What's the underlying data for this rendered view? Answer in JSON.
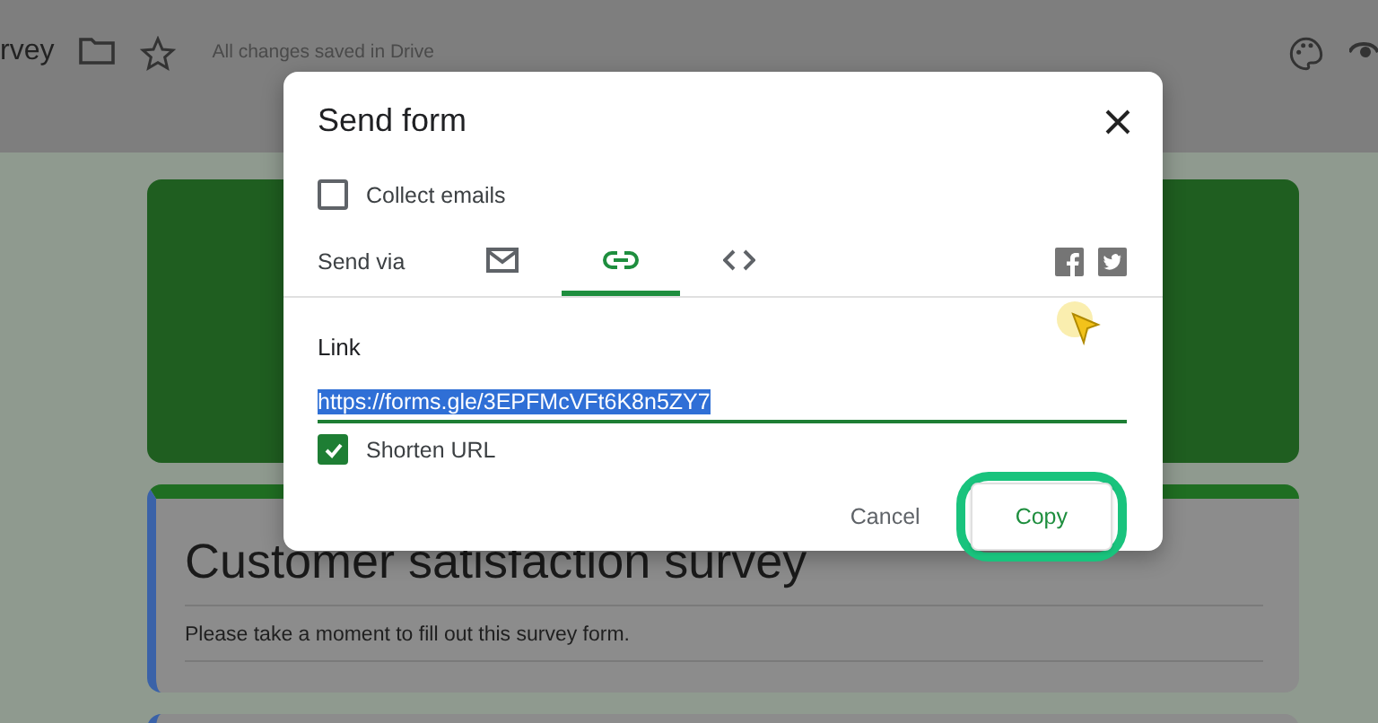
{
  "header": {
    "title": "rvey",
    "status": "All changes saved in Drive"
  },
  "dialog": {
    "title": "Send form",
    "collect_emails": {
      "label": "Collect emails",
      "checked": false
    },
    "send_via": "Send via",
    "tabs": [
      {
        "kind": "email",
        "selected": false
      },
      {
        "kind": "link",
        "selected": true
      },
      {
        "kind": "embed",
        "selected": false
      }
    ],
    "link_label": "Link",
    "link_value": "https://forms.gle/3EPFMcVFt6K8n5ZY7",
    "shorten_url": {
      "label": "Shorten URL",
      "checked": true
    },
    "buttons": [
      {
        "kind": "text",
        "label": "Cancel"
      },
      {
        "kind": "primary",
        "label": "Copy",
        "highlighted": true
      }
    ]
  },
  "form": {
    "title": "Customer satisfaction survey",
    "description": "Please take a moment to fill out this survey form."
  }
}
